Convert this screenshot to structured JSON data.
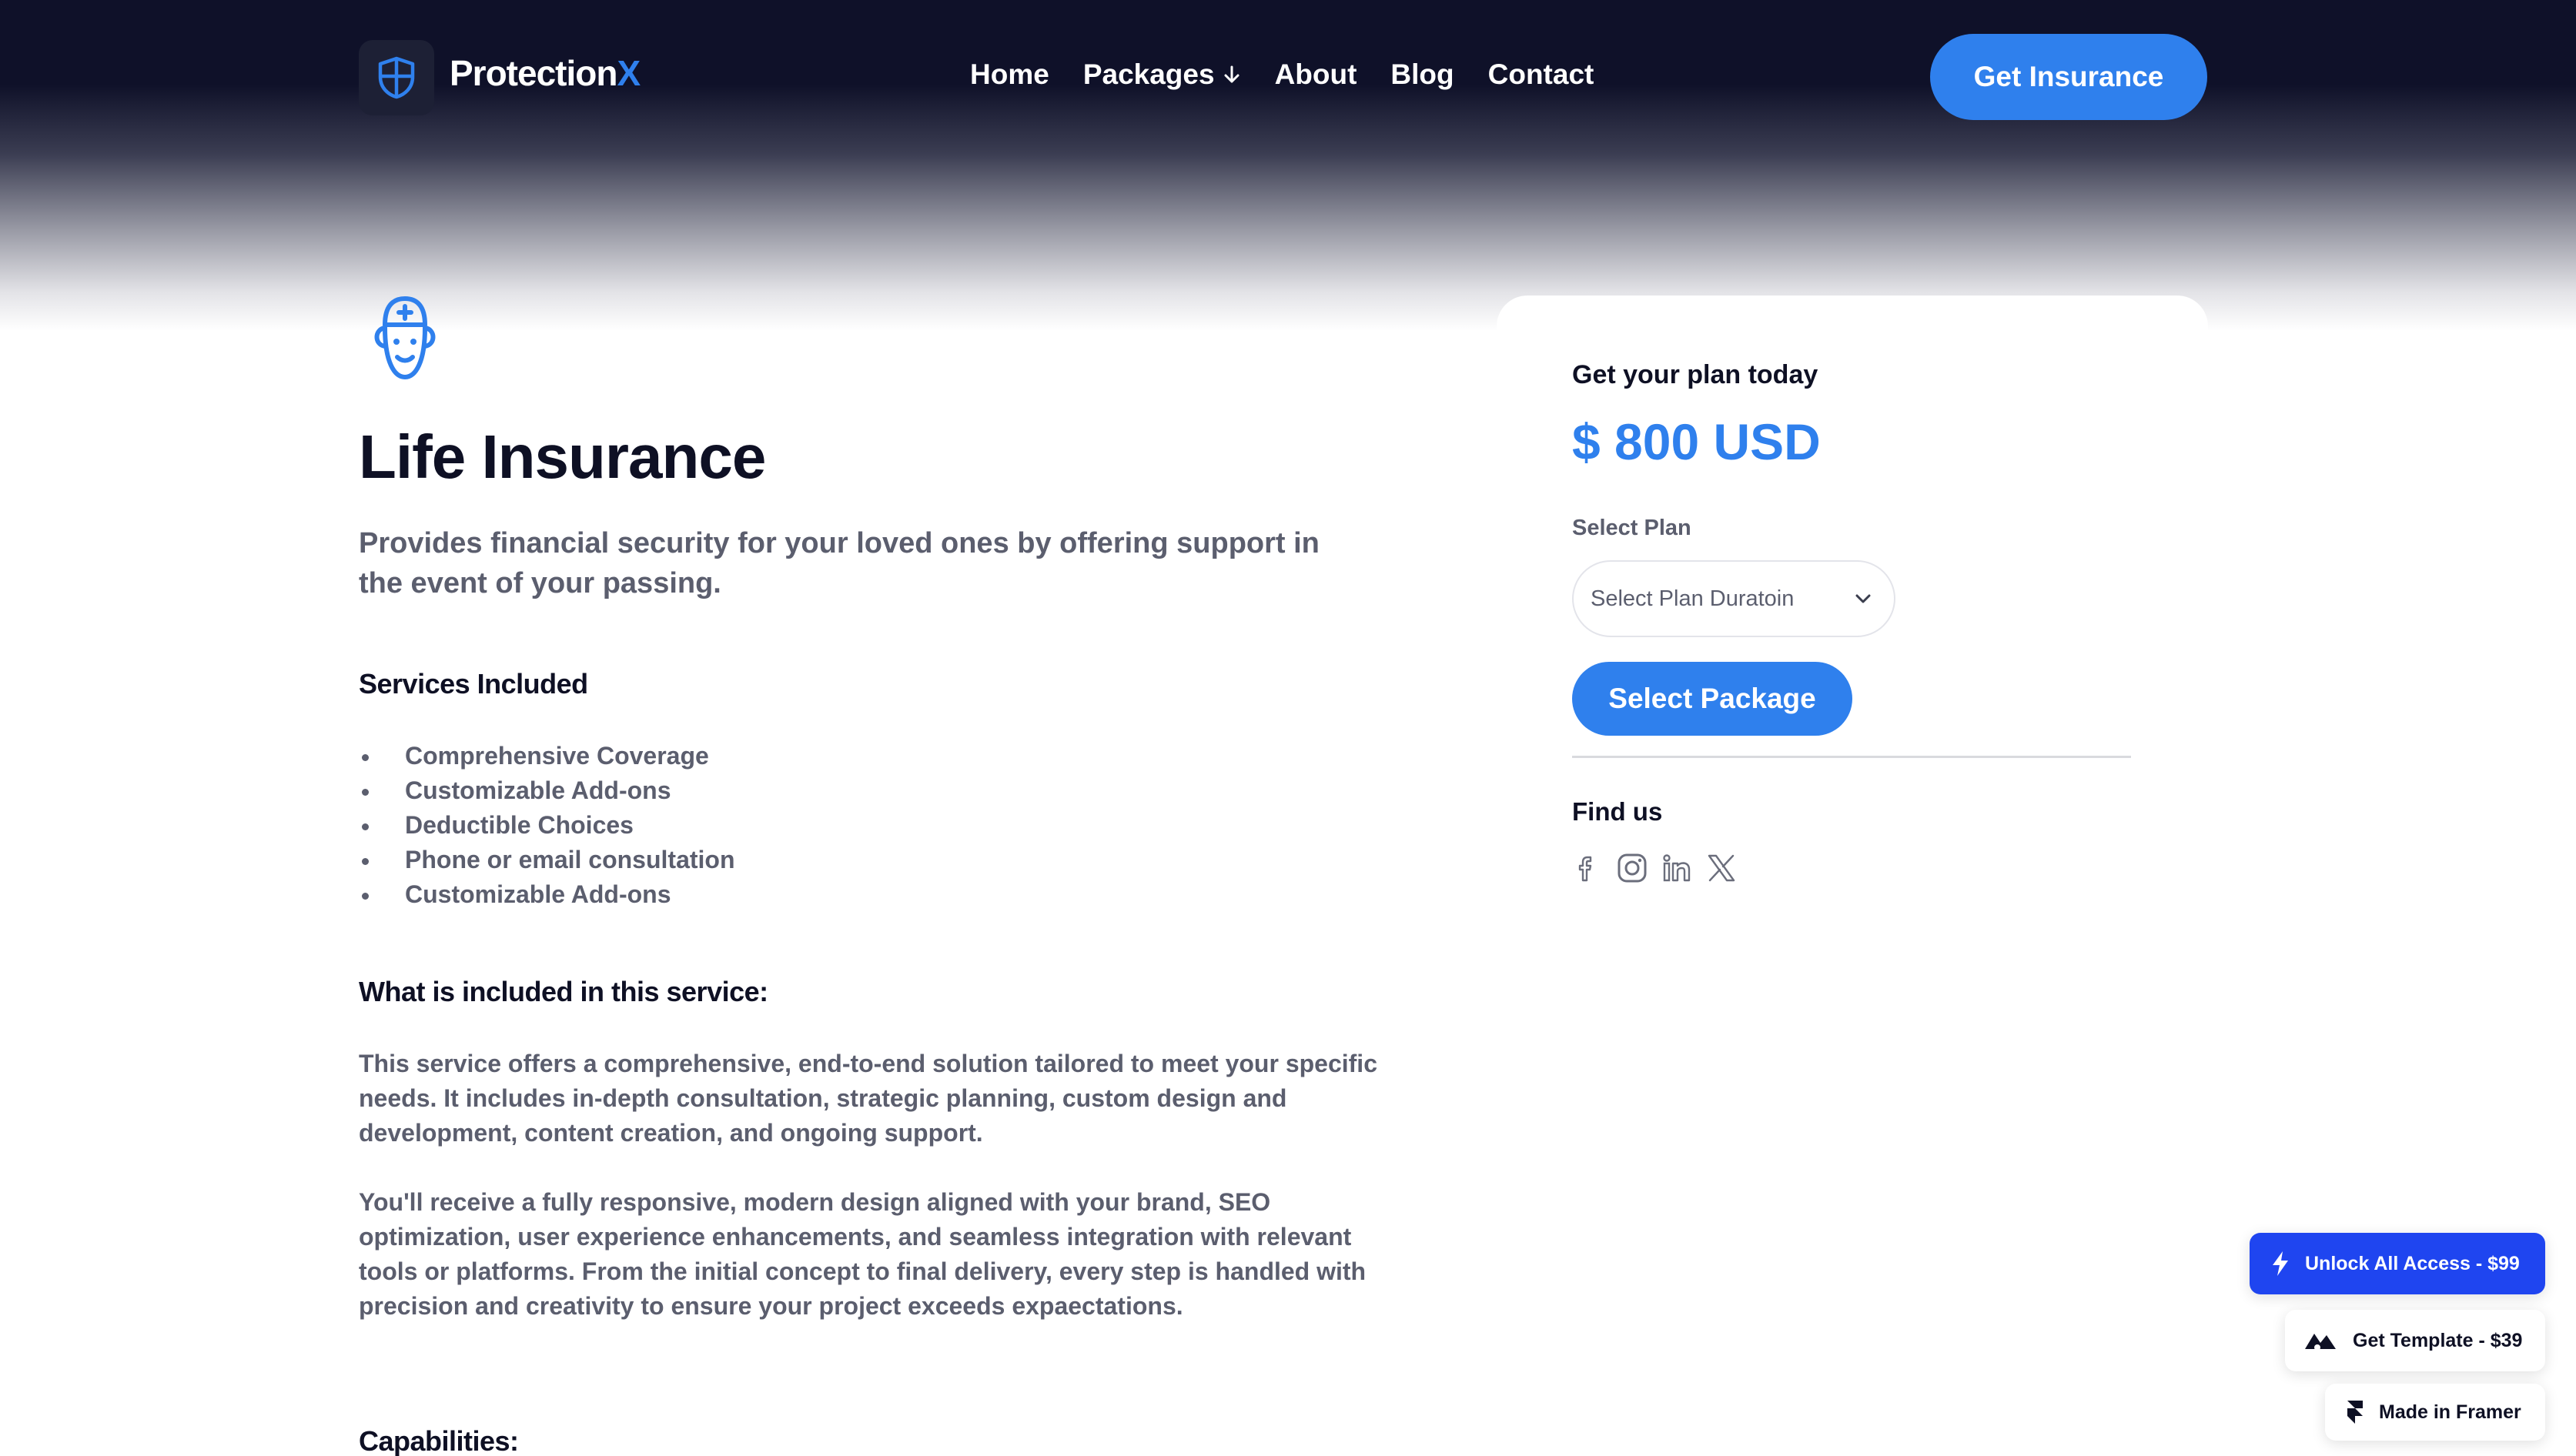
{
  "nav": {
    "brand_main": "Protection",
    "brand_accent": "X",
    "links": [
      {
        "label": "Home"
      },
      {
        "label": "Packages"
      },
      {
        "label": "About"
      },
      {
        "label": "Blog"
      },
      {
        "label": "Contact"
      }
    ],
    "cta": "Get Insurance"
  },
  "service": {
    "title": "Life Insurance",
    "lede": "Provides financial security for your loved ones by offering support in the event of your passing.",
    "services_heading": "Services Included",
    "services": [
      "Comprehensive Coverage",
      "Customizable Add-ons",
      "Deductible Choices",
      "Phone or email consultation",
      "Customizable Add-ons"
    ],
    "included_heading": "What is included in this service:",
    "paragraph1": "This service offers a comprehensive, end-to-end solution tailored to meet your specific needs. It includes in-depth consultation, strategic planning, custom design and development, content creation, and ongoing support.",
    "paragraph2": "You'll receive a fully responsive, modern design aligned with your brand, SEO optimization, user experience enhancements, and seamless integration with relevant tools or platforms. From the initial concept to final delivery, every step is handled with precision and creativity to ensure your project exceeds expaectations.",
    "capabilities_heading": "Capabilities:"
  },
  "card": {
    "label": "Get your plan today",
    "price": "$ 800 USD",
    "select_label": "Select Plan",
    "select_value": "Select Plan Duratoin",
    "button": "Select Package",
    "find_us": "Find us",
    "socials": [
      "facebook-icon",
      "instagram-icon",
      "linkedin-icon",
      "x-icon"
    ]
  },
  "badges": {
    "unlock": "Unlock All Access - $99",
    "template": "Get Template - $39",
    "framer": "Made in Framer"
  },
  "colors": {
    "accent": "#2f80ed",
    "nav_bg": "#0f1129",
    "unlock_badge": "#1f45f0",
    "body_text": "#5b5e6e"
  }
}
